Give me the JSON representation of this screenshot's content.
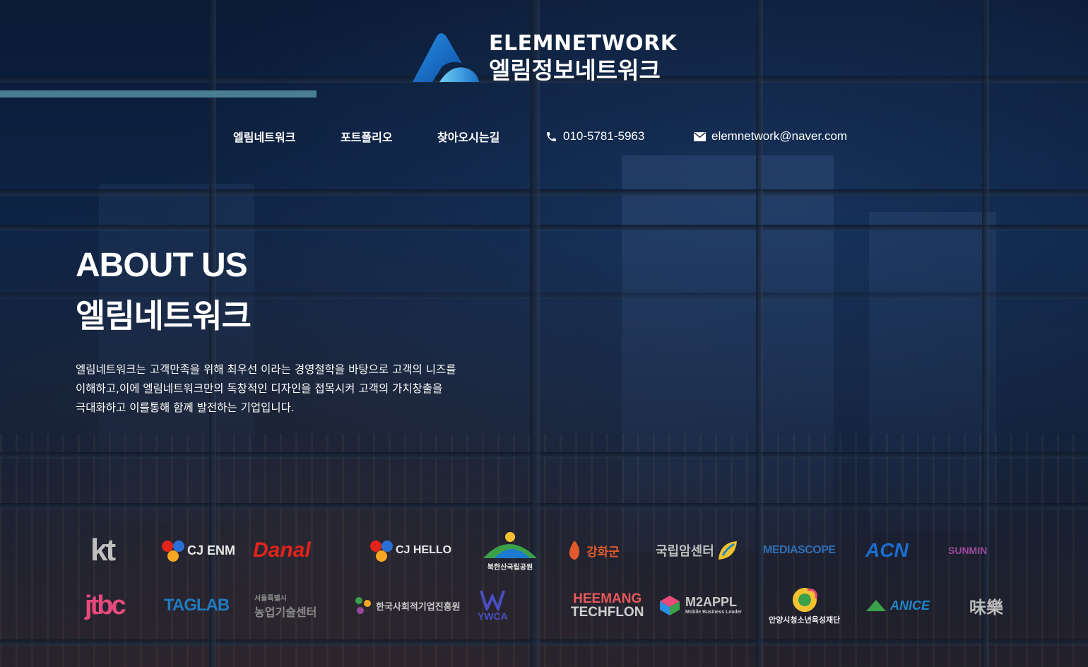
{
  "brand": {
    "name_en": "ELEMNETWORK",
    "name_ko": "엘림정보네트워크"
  },
  "nav": {
    "items": [
      {
        "label": "엘림네트워크"
      },
      {
        "label": "포트폴리오"
      },
      {
        "label": "찾아오시는길"
      }
    ],
    "phone": "010-5781-5963",
    "email": "elemnetwork@naver.com",
    "phone_icon": "phone-icon",
    "email_icon": "mail-icon"
  },
  "hero": {
    "title": "ABOUT US",
    "subtitle": "엘림네트워크",
    "description_lines": [
      "엘림네트워크는 고객만족을 위해 최우선 이라는 경영철학을 바탕으로 고객의 니즈를",
      "이해하고,이에 엘림네트워크만의 독창적인 디자인을 접목시켜 고객의 가치창출을",
      "극대화하고 이를통해 함께 발전하는 기업입니다."
    ]
  },
  "partners": {
    "row1": [
      {
        "name": "kt",
        "color": "#c9c9c9"
      },
      {
        "name": "CJ ENM",
        "color": "#e8e8e8"
      },
      {
        "name": "Danal",
        "color": "#e2231a"
      },
      {
        "name": "CJ HELLO",
        "color": "#e8e8e8"
      },
      {
        "name": "북한산국립공원",
        "color": "#3aa14a"
      },
      {
        "name": "강화군",
        "color": "#e05a2b"
      },
      {
        "name": "국립암센터",
        "color": "#c9c9c9"
      },
      {
        "name": "MEDIASCOPE",
        "color": "#2f6fb3"
      },
      {
        "name": "ACN",
        "color": "#1a6fd0"
      },
      {
        "name": "SUNMIN",
        "color": "#9b4a9a"
      }
    ],
    "row2": [
      {
        "name": "jtbc",
        "color": "#e84a7c"
      },
      {
        "name": "TAGLAB",
        "color": "#1f7bc1"
      },
      {
        "name": "농업기술센터",
        "color": "#8c8c8c"
      },
      {
        "name": "한국사회적기업진흥원",
        "color": "#c9c9c9"
      },
      {
        "name": "YWCA",
        "color": "#4a4ec4"
      },
      {
        "name": "HEEMANG TECHFLON",
        "color": "#e9575b"
      },
      {
        "name": "M2APPL",
        "color": "#c9c9c9"
      },
      {
        "name": "안양시청소년육성재단",
        "color": "#f2c230"
      },
      {
        "name": "ANICE",
        "color": "#1f87c9"
      },
      {
        "name": "味樂",
        "color": "#c9c9c9"
      }
    ],
    "row2_extra": {
      "heemang_line1": "HEEMANG",
      "heemang_line2": "TECHFLON",
      "m2appl_sub": "Mobile Business Leader",
      "anyang": "안양시청소년육성재단",
      "seoul_small": "서울특별시"
    }
  }
}
